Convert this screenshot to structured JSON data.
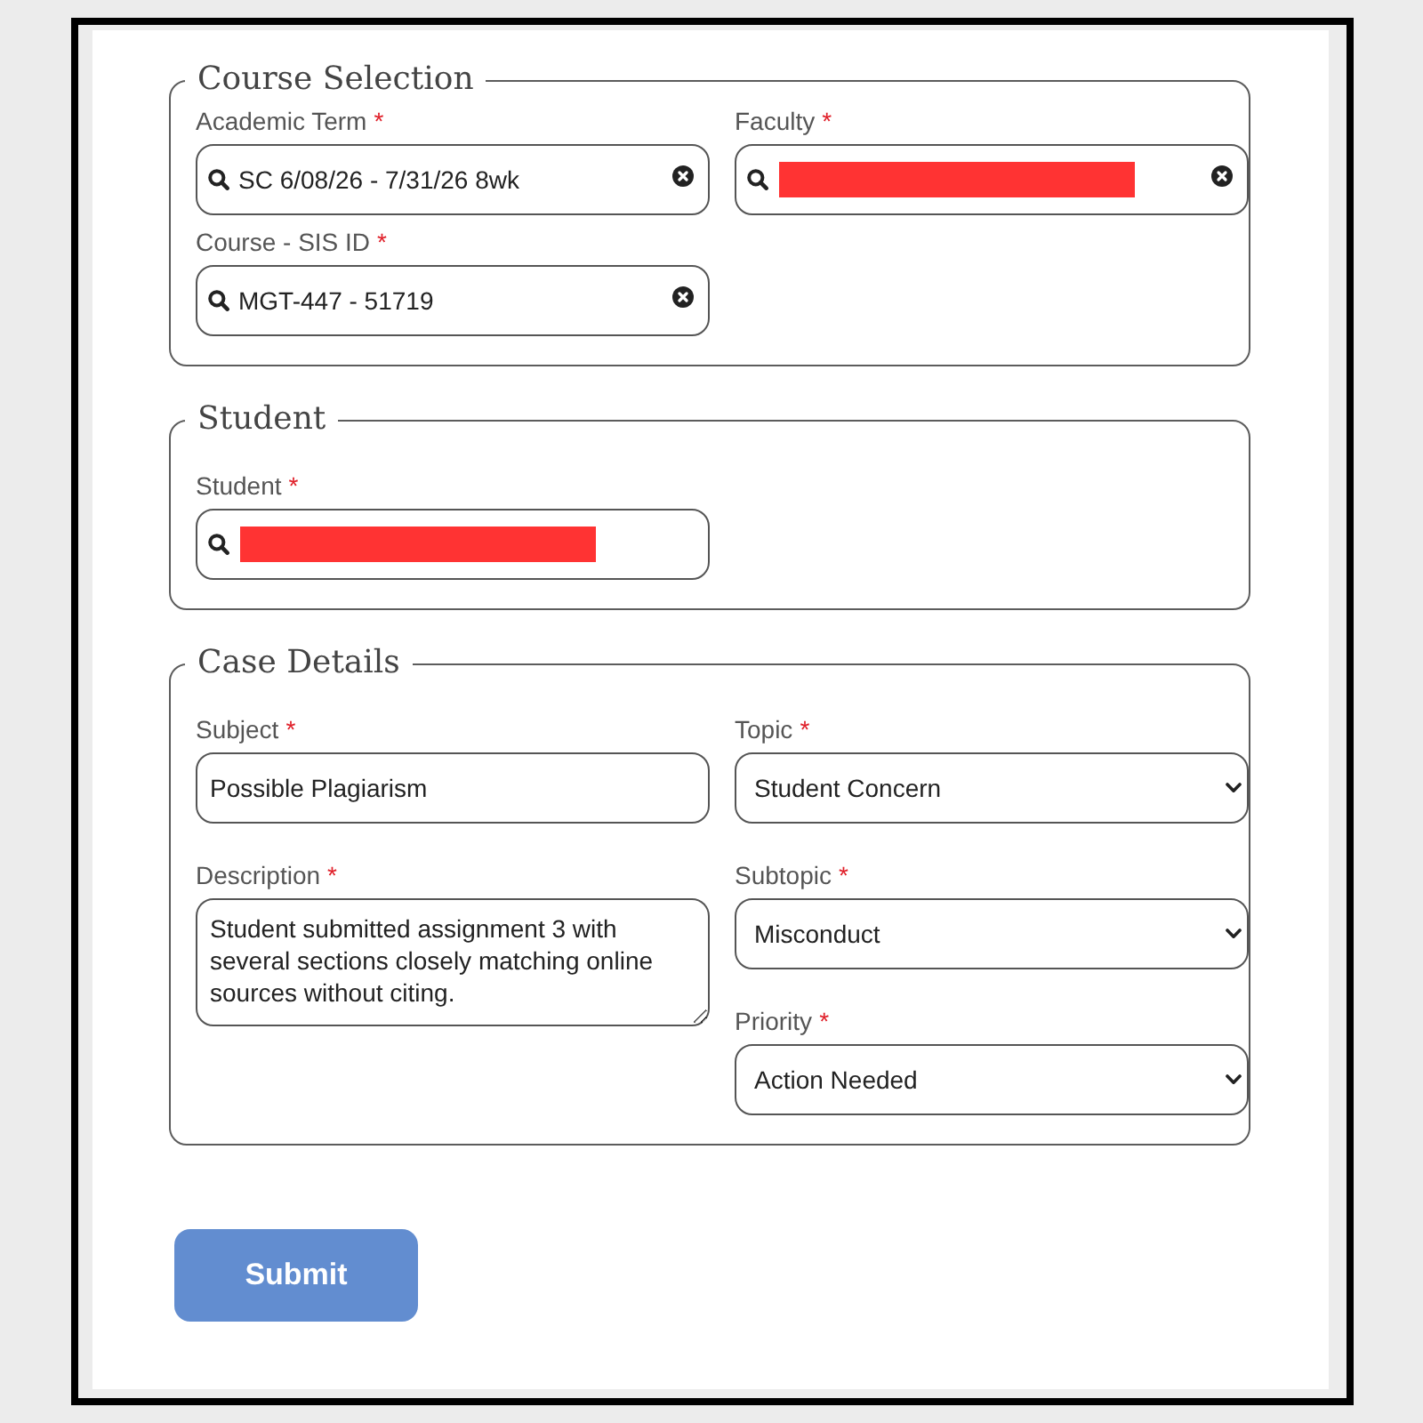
{
  "sections": [
    {
      "legend": "Course Selection",
      "columns": [
        [
          {
            "kind": "search",
            "label": "Academic Term",
            "asterisk": "*",
            "value": "SC 6/08/26 - 7/31/26 8wk",
            "redacted": false,
            "clearable": true
          },
          {
            "kind": "search",
            "label": "Course - SIS ID",
            "asterisk": "*",
            "value": "MGT-447 - 51719",
            "redacted": false,
            "clearable": true
          }
        ],
        [
          {
            "kind": "search",
            "label": "Faculty",
            "asterisk": "*",
            "redacted": true,
            "clearable": true
          }
        ]
      ]
    },
    {
      "legend": "Student",
      "columns": [
        [
          {
            "kind": "search",
            "label": "Student",
            "asterisk": "*",
            "redacted": true,
            "clearable": false
          }
        ],
        []
      ]
    },
    {
      "legend": "Case Details",
      "columns": [
        [
          {
            "kind": "text",
            "label": "Subject",
            "asterisk": "*",
            "value": "Possible Plagiarism"
          },
          {
            "kind": "textarea",
            "label": "Description",
            "asterisk": "*",
            "value": "Student submitted assignment 3 with several sections closely matching online sources without citing."
          }
        ],
        [
          {
            "kind": "select",
            "label": "Topic",
            "asterisk": "*",
            "value": "Student Concern"
          },
          {
            "kind": "select",
            "label": "Subtopic",
            "asterisk": "*",
            "value": "Misconduct"
          },
          {
            "kind": "select",
            "label": "Priority",
            "asterisk": "*",
            "value": "Action Needed"
          }
        ]
      ]
    }
  ],
  "submit": {
    "label": "Submit"
  }
}
